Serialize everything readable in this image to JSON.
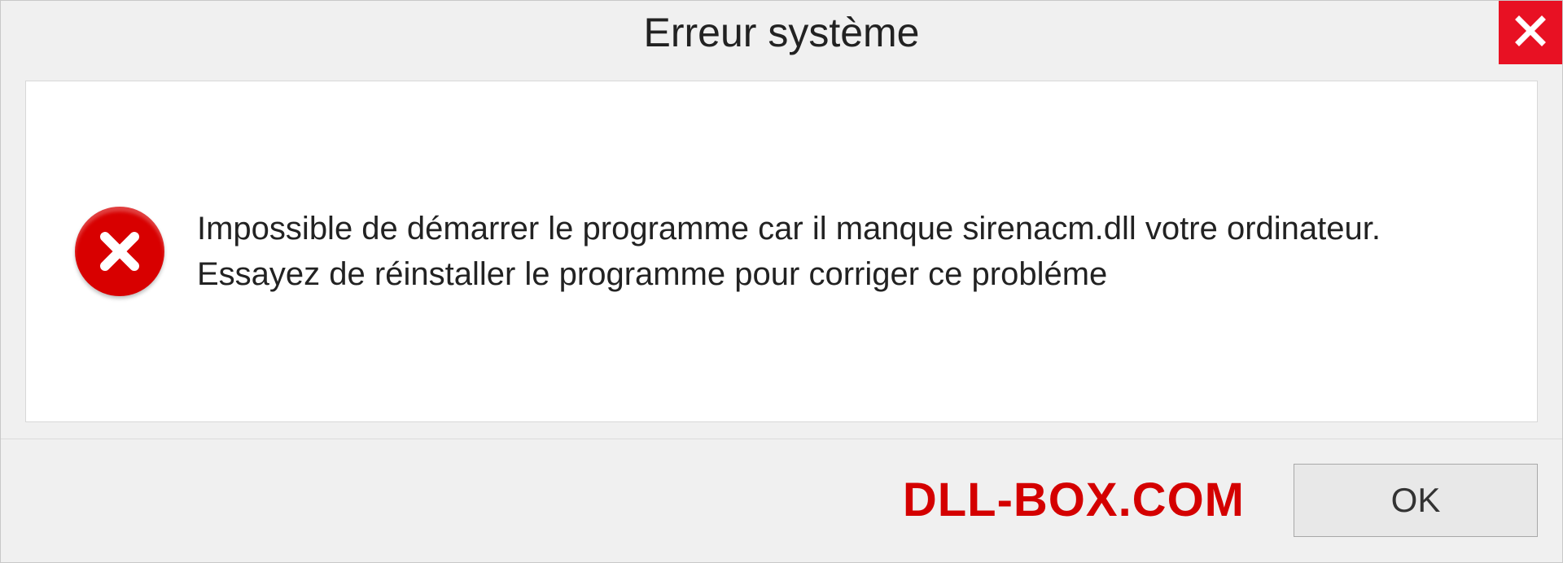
{
  "titlebar": {
    "title": "Erreur système"
  },
  "content": {
    "message": "Impossible de démarrer le programme car il manque sirenacm.dll votre ordinateur. Essayez de réinstaller le programme pour corriger ce probléme"
  },
  "footer": {
    "brand": "DLL-BOX.COM",
    "ok_label": "OK"
  },
  "colors": {
    "close_button_bg": "#e81123",
    "error_icon_bg": "#d80000",
    "brand_color": "#d40000"
  }
}
